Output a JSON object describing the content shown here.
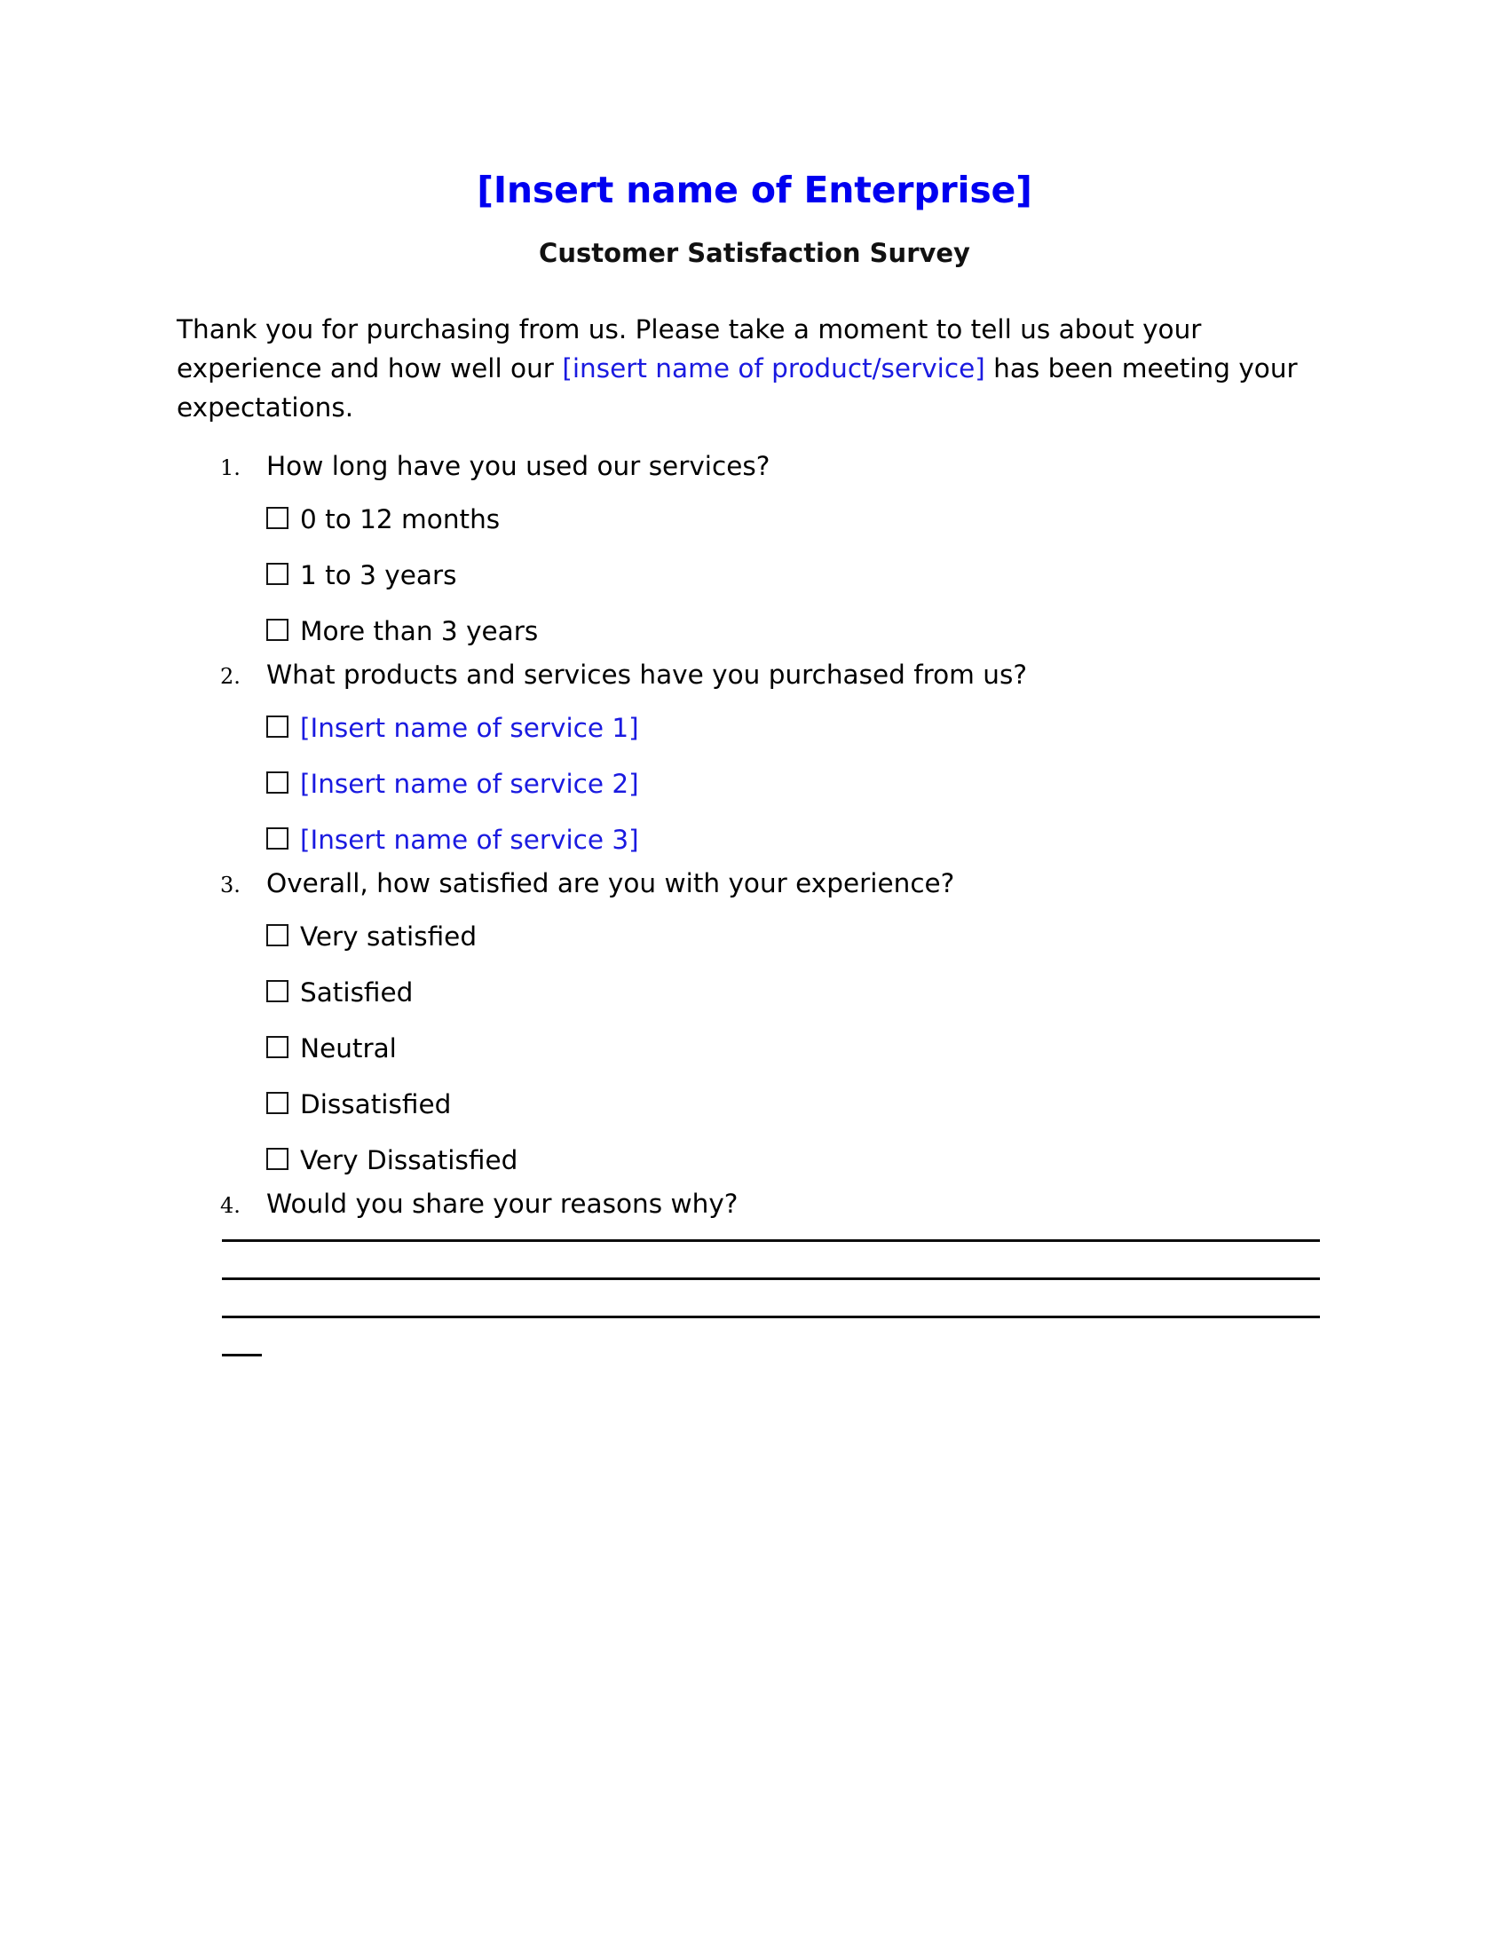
{
  "document": {
    "title": "[Insert name of Enterprise]",
    "subtitle": "Customer Satisfaction Survey",
    "title_color": "#0000f0",
    "placeholder_color": "#1a1ae0",
    "intro": {
      "part1": "Thank you for purchasing from us. Please take a moment to tell us about your experience and how well our ",
      "placeholder": "[insert name of product/service]",
      "part2": " has been meeting your expectations."
    }
  },
  "questions": [
    {
      "number": "1.",
      "text": "How long have you used our services?",
      "options": [
        {
          "label": "0 to 12 months",
          "style": "plain"
        },
        {
          "label": "1 to 3 years",
          "style": "plain"
        },
        {
          "label": "More than 3 years",
          "style": "plain"
        }
      ]
    },
    {
      "number": "2.",
      "text": "What products and services have you purchased from us?",
      "options": [
        {
          "label": "[Insert name of service 1]",
          "style": "blue"
        },
        {
          "label": "[Insert name of service 2]",
          "style": "blue"
        },
        {
          "label": "[Insert name of service 3]",
          "style": "blue"
        }
      ]
    },
    {
      "number": "3.",
      "text": "Overall, how satisfied are you with your experience?",
      "options": [
        {
          "label": "Very satisfied",
          "style": "plain"
        },
        {
          "label": "Satisfied",
          "style": "plain"
        },
        {
          "label": "Neutral",
          "style": "plain"
        },
        {
          "label": "Dissatisfied",
          "style": "plain"
        },
        {
          "label": "Very Dissatisfied",
          "style": "plain"
        }
      ]
    },
    {
      "number": "4.",
      "text": "Would you share your reasons why?",
      "options": []
    }
  ],
  "answer_lines": {
    "full_line_count": 3,
    "has_short_line": true
  }
}
